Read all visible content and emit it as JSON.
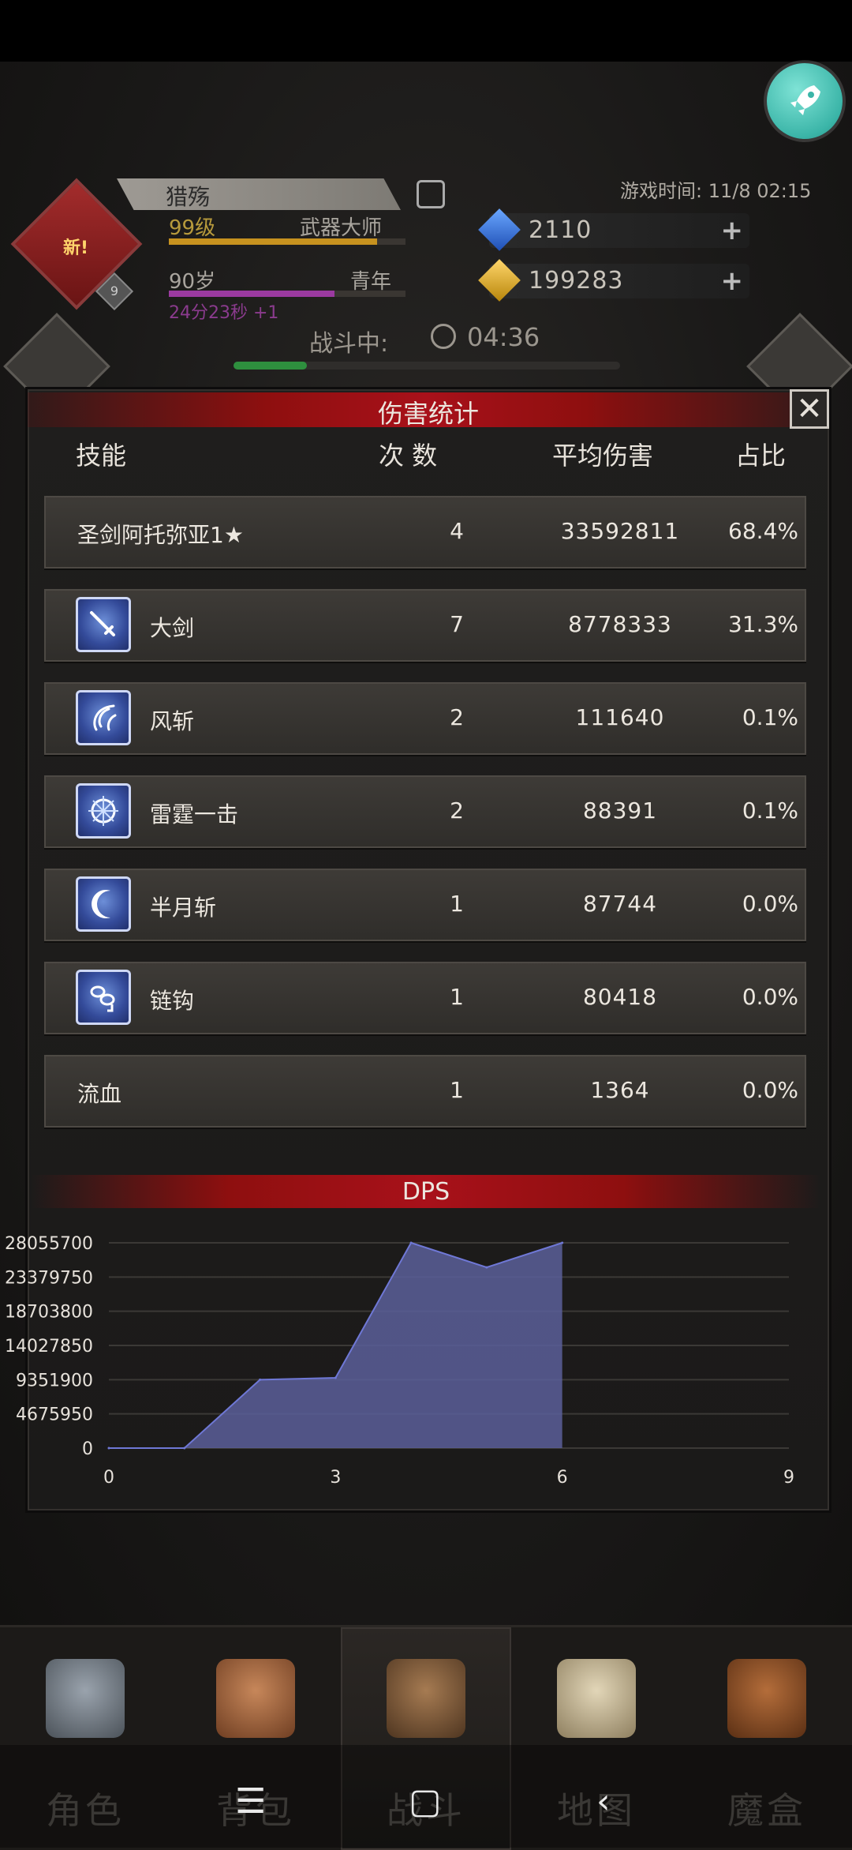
{
  "header": {
    "player_name": "猎殇",
    "new_badge": "新!",
    "avatar_level": "9",
    "level": "99级",
    "title": "武器大师",
    "age": "90岁",
    "age_stage": "青年",
    "age_timer": "24分23秒 +1",
    "game_time": "游戏时间: 11/8 02:15",
    "gems": "2110",
    "gold": "199283",
    "battle_label": "战斗中:",
    "battle_time": "04:36"
  },
  "panel": {
    "title": "伤害统计",
    "close_label": "✕",
    "columns": {
      "skill": "技能",
      "count": "次 数",
      "avg": "平均伤害",
      "pct": "占比"
    },
    "rows": [
      {
        "name": "圣剑阿托弥亚1★",
        "count": "4",
        "avg": "33592811",
        "pct": "68.4%",
        "icon": null
      },
      {
        "name": "大剑",
        "count": "7",
        "avg": "8778333",
        "pct": "31.3%",
        "icon": "greatsword-icon"
      },
      {
        "name": "风斩",
        "count": "2",
        "avg": "111640",
        "pct": "0.1%",
        "icon": "wind-slash-icon"
      },
      {
        "name": "雷霆一击",
        "count": "2",
        "avg": "88391",
        "pct": "0.1%",
        "icon": "thunder-strike-icon"
      },
      {
        "name": "半月斩",
        "count": "1",
        "avg": "87744",
        "pct": "0.0%",
        "icon": "half-moon-slash-icon"
      },
      {
        "name": "链钩",
        "count": "1",
        "avg": "80418",
        "pct": "0.0%",
        "icon": "chain-hook-icon"
      },
      {
        "name": "流血",
        "count": "1",
        "avg": "1364",
        "pct": "0.0%",
        "icon": null
      }
    ]
  },
  "chart_data": {
    "type": "area",
    "title": "DPS",
    "x": [
      0,
      1,
      2,
      3,
      4,
      5,
      6
    ],
    "values": [
      0,
      0,
      9351900,
      9600000,
      28055700,
      24700000,
      28055700
    ],
    "xlim": [
      0,
      9
    ],
    "ylim": [
      0,
      28055700
    ],
    "x_ticks": [
      "0",
      "3",
      "6",
      "9"
    ],
    "y_ticks": [
      "0",
      "4675950",
      "9351900",
      "14027850",
      "18703800",
      "23379750",
      "28055700"
    ],
    "grid": true,
    "color": "#5a5f9a"
  },
  "nav": {
    "items": [
      {
        "label": "角色",
        "icon": "character-helmet-icon"
      },
      {
        "label": "背包",
        "icon": "backpack-icon"
      },
      {
        "label": "战斗",
        "icon": "battle-shield-icon"
      },
      {
        "label": "地图",
        "icon": "map-scroll-icon"
      },
      {
        "label": "魔盒",
        "icon": "magic-box-icon"
      }
    ]
  },
  "system_bar": {
    "menu": "☰",
    "home": "▢",
    "back": "‹"
  }
}
